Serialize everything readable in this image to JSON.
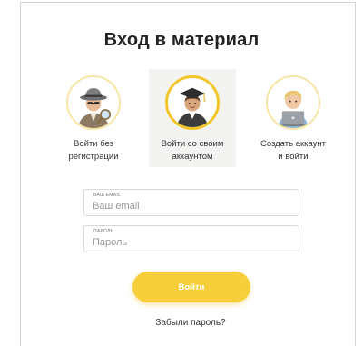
{
  "dialog": {
    "title": "Вход в материал"
  },
  "options": [
    {
      "label": "Войти без\nрегистрации",
      "icon": "spy-icon",
      "selected": false
    },
    {
      "label": "Войти со своим\nаккаунтом",
      "icon": "graduate-icon",
      "selected": true
    },
    {
      "label": "Создать аккаунт\nи войти",
      "icon": "laptop-user-icon",
      "selected": false
    }
  ],
  "form": {
    "email": {
      "caption": "ВАШ EMAIL",
      "placeholder": "Ваш email",
      "value": ""
    },
    "password": {
      "caption": "ПАРОЛЬ",
      "placeholder": "Пароль",
      "value": ""
    },
    "submit_label": "Войти",
    "forgot_label": "Забыли пароль?"
  },
  "colors": {
    "accent": "#f6cf3a",
    "selected_background": "#f3f3f1",
    "selected_ring": "#f2c529"
  }
}
